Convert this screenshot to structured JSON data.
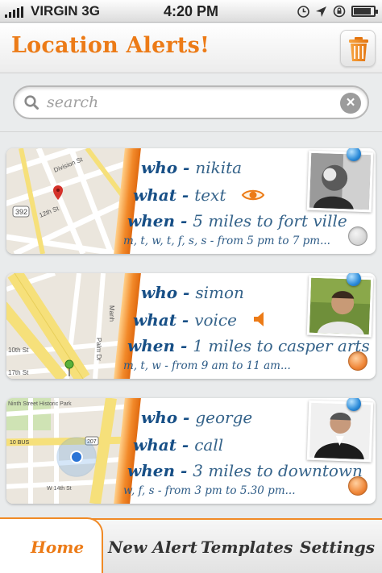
{
  "status_bar": {
    "carrier": "VIRGIN",
    "network": "3G",
    "time": "4:20 PM",
    "icons": [
      "clock-icon",
      "location-arrow-icon",
      "rotation-lock-icon",
      "battery-icon"
    ],
    "battery_level": 0.8
  },
  "header": {
    "title": "Location Alerts!",
    "trash_icon": "trash-icon"
  },
  "search": {
    "placeholder": "search",
    "value": ""
  },
  "labels": {
    "who": "who - ",
    "what": "what - ",
    "when": "when - "
  },
  "alerts": [
    {
      "who": "nikita",
      "what": "text",
      "what_icon": "eye-icon",
      "when": "5 miles to fort ville",
      "schedule": "m, t, w, t, f, s, s - from 5 pm to 7 pm...",
      "active": false,
      "map_labels": [
        "392",
        "12th St",
        "Division St"
      ]
    },
    {
      "who": "simon",
      "what": "voice",
      "what_icon": "speaker-icon",
      "when": "1 miles to casper arts",
      "schedule": "m, t, w - from 9 am to 11 am...",
      "active": true,
      "map_labels": [
        "Manh",
        "Palm Dr",
        "10th St",
        "17th St"
      ]
    },
    {
      "who": "george",
      "what": "call",
      "what_icon": "",
      "when": "3 miles to downtown",
      "schedule": "w, f, s - from 3 pm to 5.30 pm...",
      "active": true,
      "map_labels": [
        "Ninth Street Historic Park",
        "10 BUS",
        "207",
        "W 14th St"
      ]
    }
  ],
  "tabs": {
    "home": "Home",
    "new_alert": "New Alert",
    "templates": "Templates",
    "settings": "Settings"
  },
  "colors": {
    "accent": "#ec7b17",
    "label_blue": "#174f86",
    "value_blue": "#35638a"
  }
}
